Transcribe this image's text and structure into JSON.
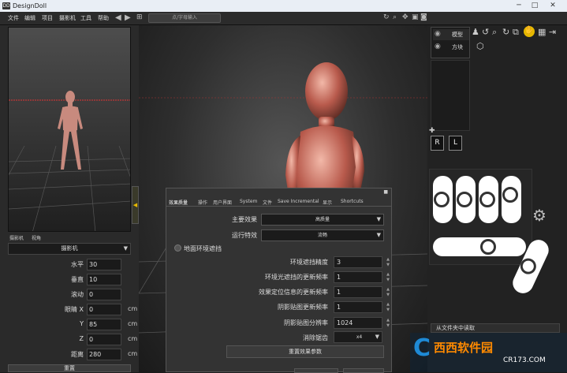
{
  "app": {
    "title": "DesignDoll",
    "icon": "DD"
  },
  "window_controls": {
    "minimize": "─",
    "maximize": "□",
    "close": "✕"
  },
  "menu": [
    "文件",
    "编辑",
    "项目",
    "摄影机",
    "工具",
    "帮助"
  ],
  "toolbar": {
    "back": "◀",
    "forward": "▶",
    "search_placeholder": "点/字母输入"
  },
  "camera_panel": {
    "tabs": [
      "摄影机",
      "视角"
    ],
    "camera_select": "摄影机",
    "rows": [
      {
        "label": "水平",
        "value": "30",
        "unit": ""
      },
      {
        "label": "垂直",
        "value": "10",
        "unit": ""
      },
      {
        "label": "滚动",
        "value": "0",
        "unit": ""
      },
      {
        "label": "眼睛 X",
        "value": "0",
        "unit": "cm"
      },
      {
        "label": "Y",
        "value": "85",
        "unit": "cm"
      },
      {
        "label": "Z",
        "value": "0",
        "unit": "cm"
      },
      {
        "label": "距离",
        "value": "280",
        "unit": "cm"
      }
    ],
    "reset_button": "重置"
  },
  "right_panel": {
    "items": [
      {
        "label": "模型"
      },
      {
        "label": "方块"
      }
    ],
    "r_label": "R",
    "l_label": "L",
    "folder_button": "从文件夹中读取"
  },
  "settings_dialog": {
    "tabs": [
      "效果质量",
      "操作",
      "用户界面",
      "System",
      "文件",
      "Save Incremental",
      "显示",
      "Shortcuts"
    ],
    "main_effect_label": "主要效果",
    "main_effect_value": "高质量",
    "runtime_effect_label": "运行特效",
    "runtime_effect_value": "流畅",
    "ground_ao_label": "地面环境遮挡",
    "fields": [
      {
        "label": "环境遮挡精度",
        "value": "3"
      },
      {
        "label": "环境光遮挡的更新频率",
        "value": "1"
      },
      {
        "label": "效果定位信息的更新频率",
        "value": "1"
      },
      {
        "label": "阴影贴图更新频率",
        "value": "1"
      },
      {
        "label": "阴影贴图分辨率",
        "value": "1024"
      }
    ],
    "aa_label": "消除锯齿",
    "aa_value": "x4",
    "reset_quality_button": "重置效果参数"
  },
  "watermark": {
    "text": "西西软件园",
    "url": "CR173.COM"
  }
}
